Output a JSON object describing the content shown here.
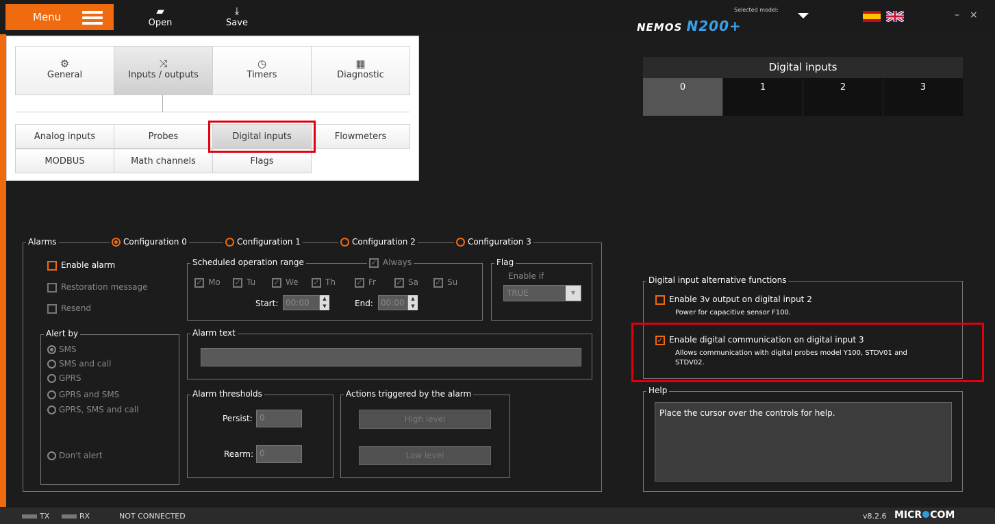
{
  "topbar": {
    "menu_label": "Menu",
    "open_label": "Open",
    "save_label": "Save",
    "selected_model_label": "Selected model:",
    "model_name_prefix": "NEMOS",
    "model_name_suffix": "N200+",
    "minimize": "–",
    "close": "×",
    "languages": [
      "es",
      "en"
    ]
  },
  "menu": {
    "tabs": [
      {
        "label": "General",
        "icon": "gear-icon"
      },
      {
        "label": "Inputs / outputs",
        "icon": "shuffle-icon"
      },
      {
        "label": "Timers",
        "icon": "timer-icon"
      },
      {
        "label": "Diagnostic",
        "icon": "chip-icon"
      }
    ],
    "subtabs": [
      "Analog inputs",
      "Probes",
      "Digital inputs",
      "Flowmeters",
      "MODBUS",
      "Math channels",
      "Flags"
    ],
    "selected_tab": "Inputs / outputs",
    "selected_subtab": "Digital inputs"
  },
  "digital_inputs": {
    "title": "Digital inputs",
    "channels": [
      "0",
      "1",
      "2",
      "3"
    ],
    "selected": "0"
  },
  "alarms": {
    "label": "Alarms",
    "configurations": [
      "Configuration 0",
      "Configuration 1",
      "Configuration 2",
      "Configuration 3"
    ],
    "selected_configuration": "Configuration 0",
    "enable_alarm": "Enable alarm",
    "restoration_message": "Restoration message",
    "resend": "Resend",
    "alert_by": {
      "label": "Alert by",
      "options": [
        "SMS",
        "SMS and call",
        "GPRS",
        "GPRS and SMS",
        "GPRS, SMS and call"
      ],
      "dont_alert": "Don't alert",
      "selected": "SMS"
    },
    "schedule": {
      "label": "Scheduled operation range",
      "always": "Always",
      "days": [
        "Mo",
        "Tu",
        "We",
        "Th",
        "Fr",
        "Sa",
        "Su"
      ],
      "start_label": "Start:",
      "start_value": "00:00",
      "end_label": "End:",
      "end_value": "00:00"
    },
    "flag": {
      "label": "Flag",
      "enable_if": "Enable if",
      "value": "TRUE"
    },
    "alarm_text": {
      "label": "Alarm text",
      "value": ""
    },
    "thresholds": {
      "label": "Alarm thresholds",
      "persist_label": "Persist:",
      "persist_value": "0",
      "rearm_label": "Rearm:",
      "rearm_value": "0"
    },
    "actions": {
      "label": "Actions triggered by the alarm",
      "high": "High level",
      "low": "Low level"
    }
  },
  "alt_functions": {
    "label": "Digital input alternative functions",
    "opt1_title": "Enable 3v output on digital input 2",
    "opt1_desc": "Power for capacitive sensor F100.",
    "opt1_checked": false,
    "opt2_title": "Enable digital communication on digital input 3",
    "opt2_desc1": "Allows communication with digital probes model Y100, STDV01 and",
    "opt2_desc2": "STDV02.",
    "opt2_checked": true
  },
  "help": {
    "label": "Help",
    "text": "Place the cursor over the controls for help."
  },
  "status": {
    "tx": "TX",
    "rx": "RX",
    "connection": "NOT CONNECTED",
    "version": "v8.2.6",
    "brand": "MICR",
    "brand_tail": "COM"
  },
  "colors": {
    "accent": "#f06a0f",
    "highlight_box": "#e00010",
    "background": "#1c1c1c"
  }
}
